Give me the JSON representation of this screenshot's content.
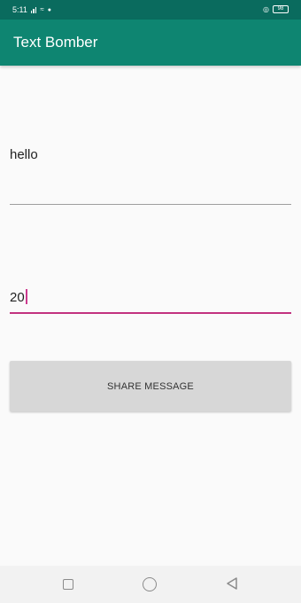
{
  "status_bar": {
    "time": "5:11",
    "battery": "98",
    "icons": [
      "signal-icon",
      "wifi-icon",
      "alarm-icon",
      "battery-icon"
    ]
  },
  "app_bar": {
    "title": "Text Bomber",
    "color": "#0e8571"
  },
  "form": {
    "message_value": "hello",
    "count_value": "20",
    "share_button_label": "SHARE MESSAGE"
  },
  "nav_bar": {
    "icons": [
      "recent-apps-icon",
      "home-icon",
      "back-icon"
    ]
  },
  "colors": {
    "status_bar": "#0a6b5e",
    "accent": "#c2327f",
    "button": "#d7d7d7"
  }
}
